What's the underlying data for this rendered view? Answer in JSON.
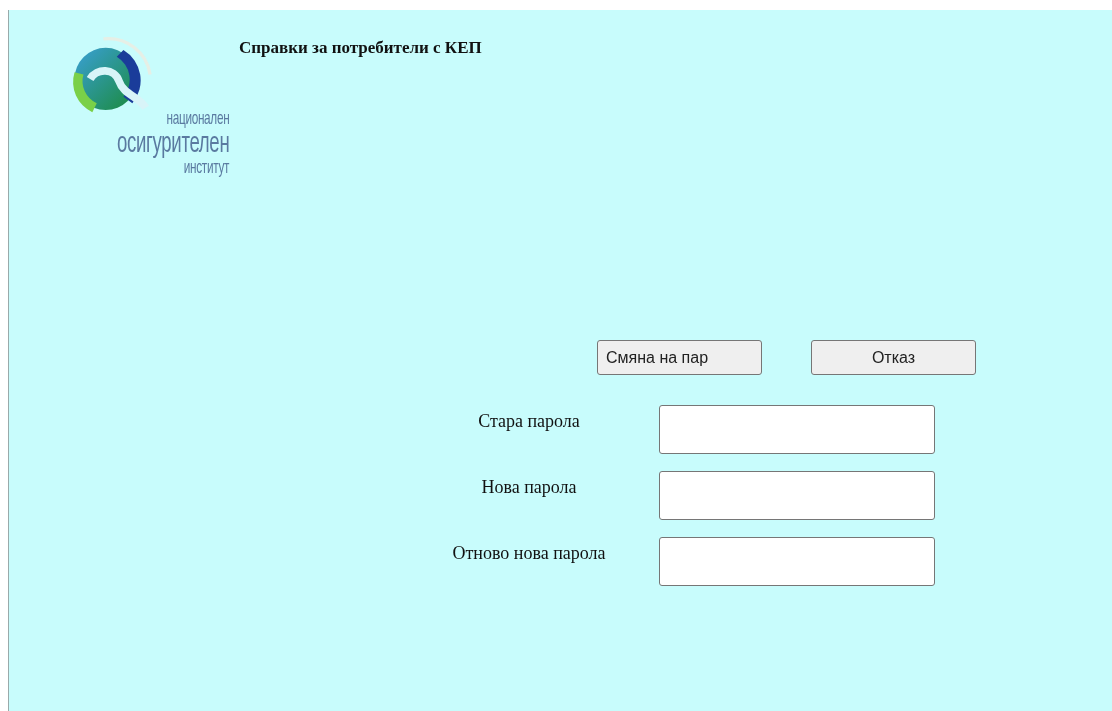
{
  "header": {
    "title": "Справки за потребители с КЕП"
  },
  "logo": {
    "lines": [
      "национален",
      "осигурителен",
      "институт"
    ]
  },
  "buttons": [
    {
      "label": "Смяна на пар"
    },
    {
      "label": "Отказ"
    }
  ],
  "fields": [
    {
      "label": "Стара парола"
    },
    {
      "label": "Нова парола"
    },
    {
      "label": "Отново нова парола"
    }
  ]
}
